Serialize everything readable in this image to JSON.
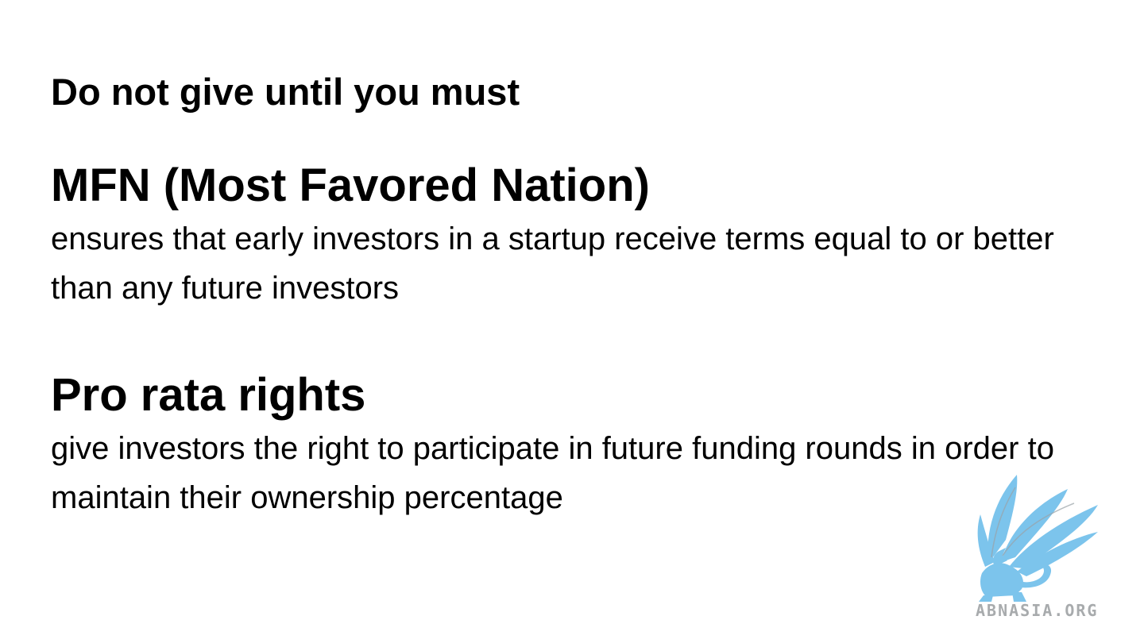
{
  "slide": {
    "heading": "Do not give until you must",
    "sections": [
      {
        "title": "MFN (Most Favored Nation)",
        "body": "ensures that early investors in a startup receive terms equal to or better than any future investors"
      },
      {
        "title": "Pro rata rights",
        "body": "give investors the right to participate in future funding rounds in order to maintain their ownership percentage"
      }
    ]
  },
  "watermark": {
    "text": "ABNASIA.ORG",
    "icon": "griffin-logo-icon",
    "color": "#7cc4ec",
    "text_color": "#a8abad"
  }
}
